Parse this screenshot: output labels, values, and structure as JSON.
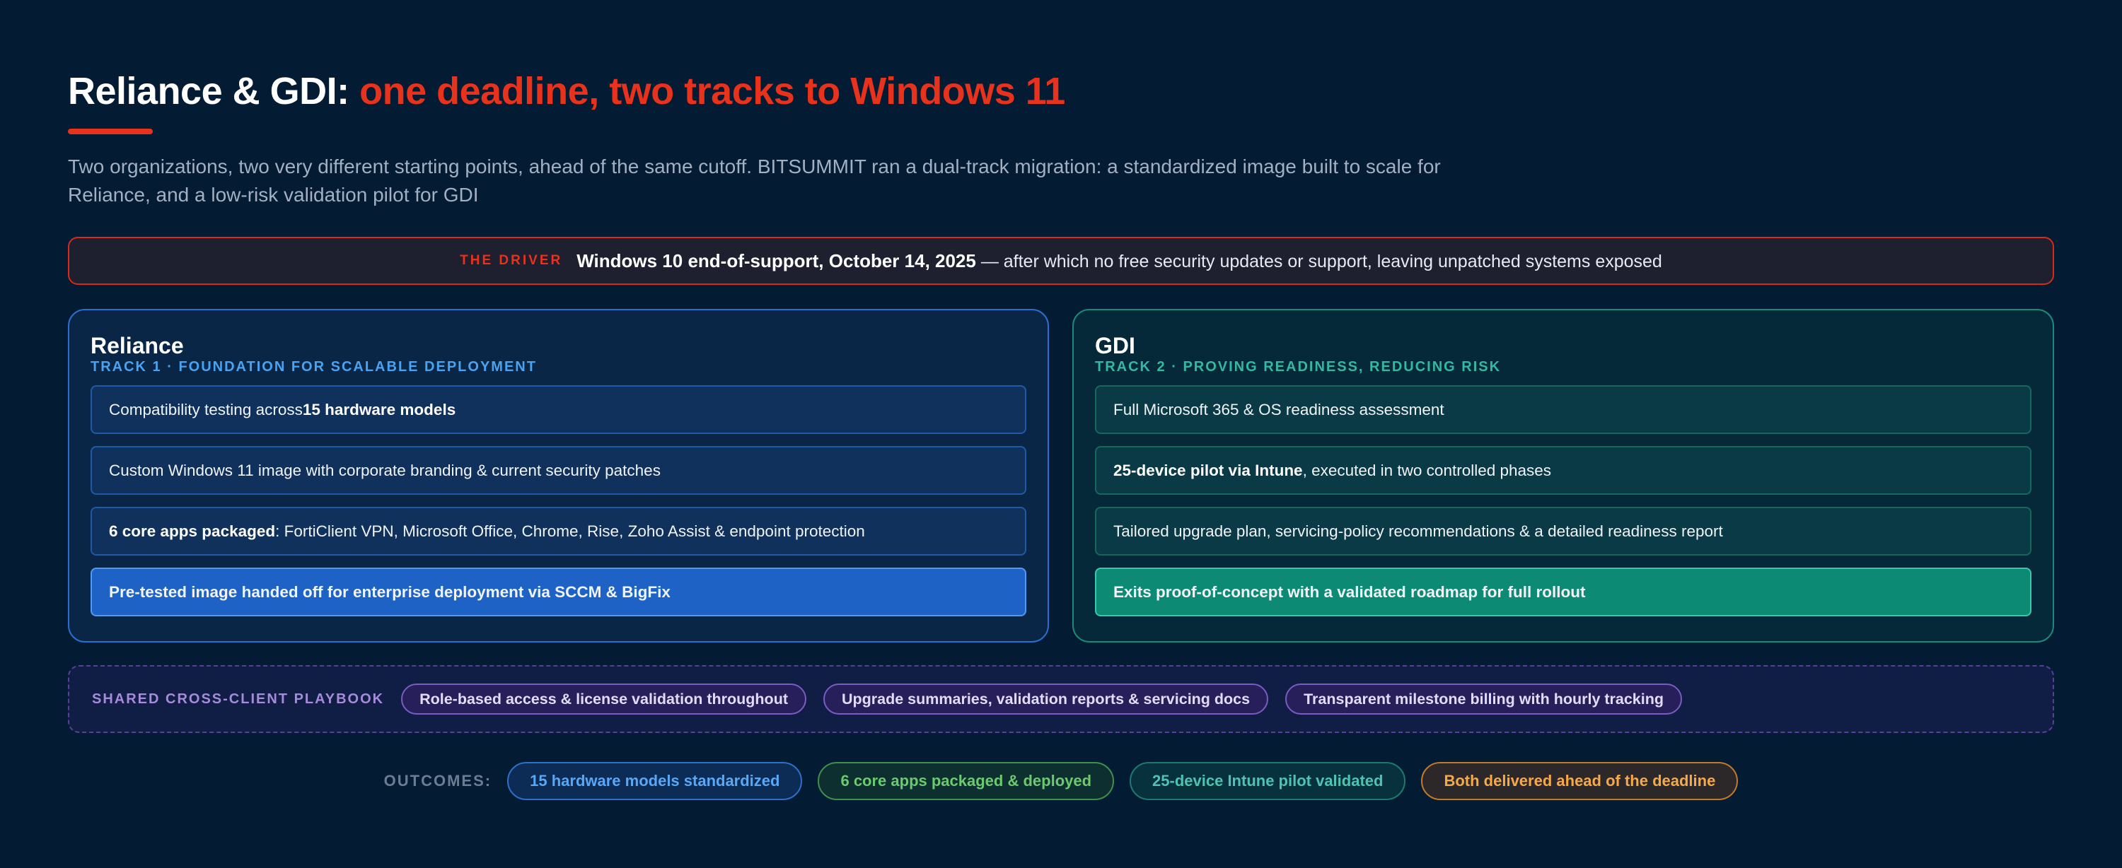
{
  "header": {
    "title_main": "Reliance & GDI:",
    "title_accent": "one deadline, two tracks to Windows 11",
    "subtitle": "Two organizations, two very different starting points, ahead of the same cutoff. BITSUMMIT ran a dual-track migration: a standardized image built to scale for Reliance, and a low-risk validation pilot for GDI"
  },
  "driver": {
    "tag": "THE DRIVER",
    "date": "Windows 10 end-of-support, October 14, 2025",
    "rest": "— after which no free security updates or support, leaving unpatched systems exposed"
  },
  "tracks": {
    "reliance": {
      "name": "Reliance",
      "sub": "TRACK 1 · FOUNDATION FOR SCALABLE DEPLOYMENT",
      "items": [
        {
          "pre": "Compatibility testing across ",
          "bold": "15 hardware models",
          "post": ""
        },
        {
          "pre": "Custom Windows 11 image with corporate branding & current security patches",
          "bold": "",
          "post": ""
        },
        {
          "pre": "",
          "bold": "6 core apps packaged",
          "post": ": FortiClient VPN, Microsoft Office, Chrome, Rise, Zoho Assist & endpoint protection"
        },
        {
          "pre": "Pre-tested image handed off for enterprise deployment via SCCM & BigFix",
          "bold": "",
          "post": ""
        }
      ]
    },
    "gdi": {
      "name": "GDI",
      "sub": "TRACK 2 · PROVING READINESS, REDUCING RISK",
      "items": [
        {
          "pre": "Full Microsoft 365 & OS readiness assessment",
          "bold": "",
          "post": ""
        },
        {
          "pre": "",
          "bold": "25-device pilot via Intune",
          "post": ", executed in two controlled phases"
        },
        {
          "pre": "Tailored upgrade plan, servicing-policy recommendations & a detailed readiness report",
          "bold": "",
          "post": ""
        },
        {
          "pre": "Exits proof-of-concept with a validated roadmap for full rollout",
          "bold": "",
          "post": ""
        }
      ]
    }
  },
  "playbook": {
    "label": "SHARED CROSS-CLIENT PLAYBOOK",
    "pills": [
      "Role-based access & license validation throughout",
      "Upgrade summaries, validation reports & servicing docs",
      "Transparent milestone billing with hourly tracking"
    ]
  },
  "outcomes": {
    "label": "OUTCOMES:",
    "pills": [
      "15 hardware models standardized",
      "6 core apps packaged & deployed",
      "25-device Intune pilot validated",
      "Both delivered ahead of the deadline"
    ]
  },
  "colors": {
    "background": "#041c33",
    "accent_red": "#e8321c",
    "reliance_blue": "#2a6fd0",
    "gdi_teal": "#1b8a78",
    "playbook_purple": "#7b5bc4",
    "outcome_orange": "#f5a94a"
  }
}
